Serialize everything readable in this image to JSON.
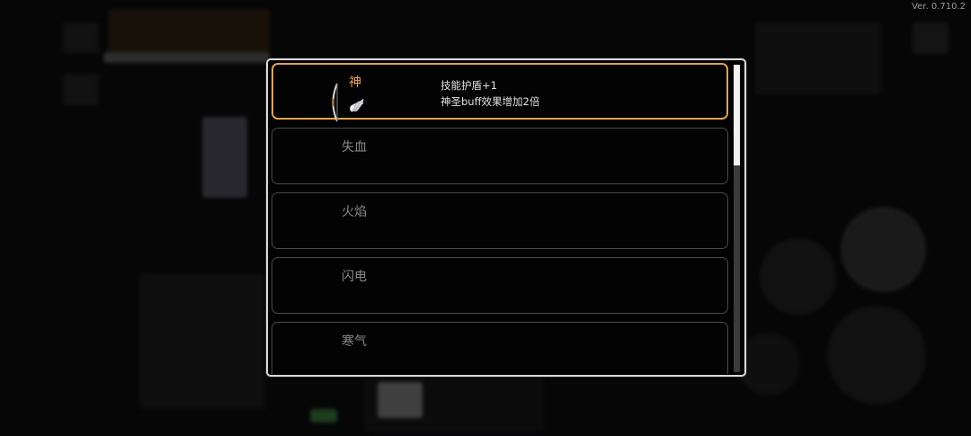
{
  "version": "Ver. 0.710.2",
  "colors": {
    "selected_border": "#e0a44a",
    "selected_title": "#e8a54c",
    "card_border": "#4a4a4a"
  },
  "cards": [
    {
      "title": "神",
      "selected": true,
      "desc_lines": [
        "技能护盾+1",
        "神圣buff效果增加2倍"
      ],
      "icon": "bow-icon",
      "badge_icon": "wing-icon"
    },
    {
      "title": "失血",
      "selected": false
    },
    {
      "title": "火焰",
      "selected": false
    },
    {
      "title": "闪电",
      "selected": false
    },
    {
      "title": "寒气",
      "selected": false
    }
  ],
  "scroll_position": 0
}
